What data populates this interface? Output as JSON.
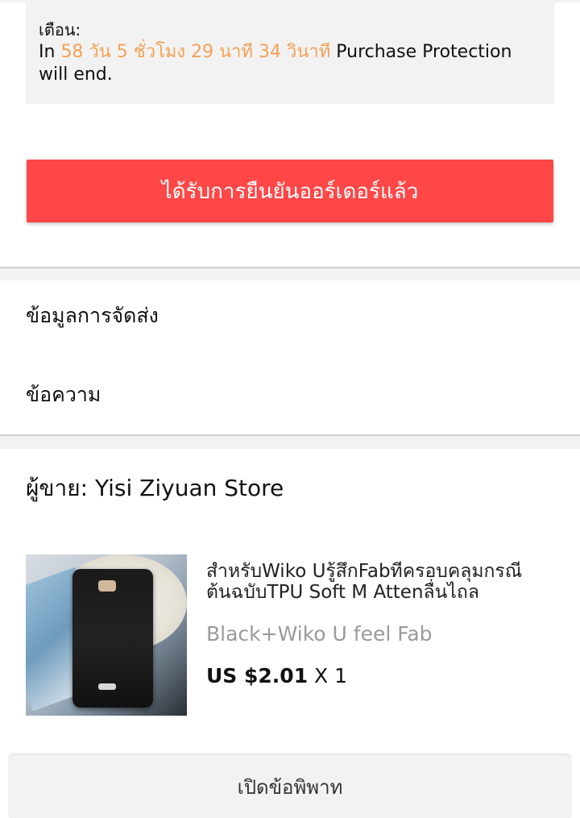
{
  "notice": {
    "title": "เตือน:",
    "prefix": "In",
    "countdown": "58 วัน 5 ชั่วโมง 29 นาที 34 วินาที",
    "suffix": "Purchase Protection will end."
  },
  "confirm_button": {
    "label": "ได้รับการยืนยันออร์เดอร์แล้ว"
  },
  "menu": {
    "shipping_info": "ข้อมูลการจัดส่ง",
    "messages": "ข้อความ"
  },
  "seller": {
    "label": "ผู้ขาย: Yisi Ziyuan Store"
  },
  "product": {
    "title": "สำหรับWiko Uรู้สึกFabที่ครอบคลุมกรณีต้นฉบับTPU Soft M Attenลื่นไถล",
    "variant": "Black+Wiko U feel Fab",
    "price": "US $2.01",
    "quantity": "X 1"
  },
  "dispute_button": {
    "label": "เปิดข้อพิพาท"
  },
  "colors": {
    "accent_orange": "#f5a154",
    "primary_red": "#ff4747",
    "background_gray": "#f2f2f2"
  },
  "icons": {
    "product_thumbnail": "black-phone-case-image"
  }
}
